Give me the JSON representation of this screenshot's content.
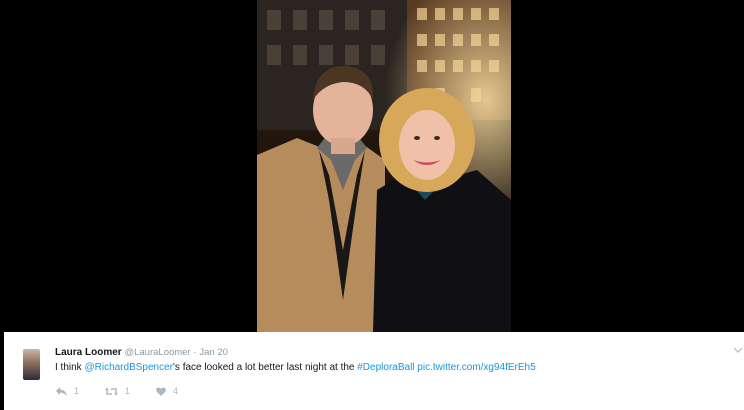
{
  "tweet": {
    "display_name": "Laura Loomer",
    "handle": "@LauraLoomer",
    "separator": "·",
    "date": "Jan 20",
    "text_1": "I think ",
    "mention": "@RichardBSpencer",
    "text_2": "'s face looked a lot better last night at the ",
    "hashtag": "#DeploraBall",
    "text_3": " ",
    "link": "pic.twitter.com/xg94fErEh5",
    "reply_count": "1",
    "retweet_count": "1",
    "like_count": "4"
  },
  "icons": {
    "reply": "reply-icon",
    "retweet": "retweet-icon",
    "like": "heart-icon",
    "more": "chevron-down-icon"
  },
  "colors": {
    "link": "#1b95e0",
    "muted": "#8899a6",
    "text": "#14171a",
    "action": "#aab8c2"
  }
}
